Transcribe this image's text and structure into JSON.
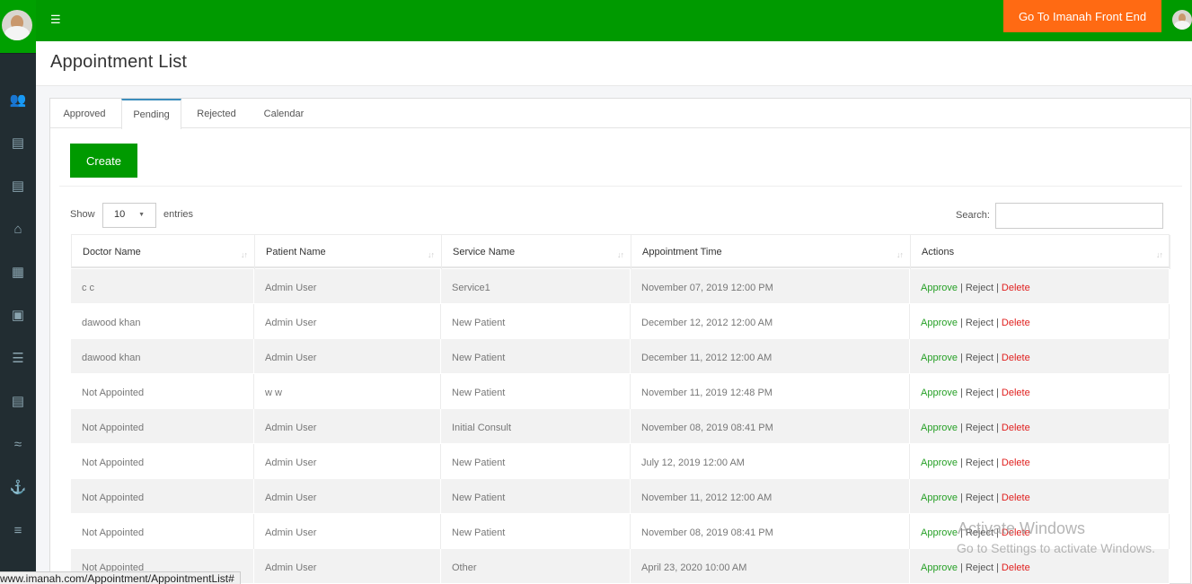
{
  "header": {
    "menu_icon": "hamburger-icon",
    "front_end_button": "Go To Imanah Front End",
    "accent": "#009a00",
    "button_color": "#ff6a13"
  },
  "sidebar": {
    "icons": [
      "users-icon",
      "id-card-icon",
      "id-card-icon",
      "home-icon",
      "calendar-icon",
      "image-icon",
      "list-icon",
      "id-card-icon",
      "handshake-icon",
      "anchor-icon",
      "document-icon"
    ]
  },
  "page": {
    "title": "Appointment List"
  },
  "tabs": [
    "Approved",
    "Pending",
    "Rejected",
    "Calendar"
  ],
  "active_tab": "Pending",
  "create_label": "Create",
  "table_controls": {
    "show_label": "Show",
    "page_length": "10",
    "entries_label": "entries",
    "search_label": "Search:"
  },
  "table": {
    "headers": [
      "Doctor Name",
      "Patient Name",
      "Service Name",
      "Appointment Time",
      "Actions"
    ],
    "actions": {
      "approve": "Approve",
      "reject": "Reject",
      "delete": "Delete",
      "sep": "|"
    },
    "rows": [
      [
        "c c",
        "Admin User",
        "Service1",
        "November 07, 2019 12:00 PM"
      ],
      [
        "dawood khan",
        "Admin User",
        "New Patient",
        "December 12, 2012 12:00 AM"
      ],
      [
        "dawood khan",
        "Admin User",
        "New Patient",
        "December 11, 2012 12:00 AM"
      ],
      [
        "Not Appointed",
        "w w",
        "New Patient",
        "November 11, 2019 12:48 PM"
      ],
      [
        "Not Appointed",
        "Admin User",
        "Initial Consult",
        "November 08, 2019 08:41 PM"
      ],
      [
        "Not Appointed",
        "Admin User",
        "New Patient",
        "July 12, 2019 12:00 AM"
      ],
      [
        "Not Appointed",
        "Admin User",
        "New Patient",
        "November 11, 2012 12:00 AM"
      ],
      [
        "Not Appointed",
        "Admin User",
        "New Patient",
        "November 08, 2019 08:41 PM"
      ],
      [
        "Not Appointed",
        "Admin User",
        "Other",
        "April 23, 2020 10:00 AM"
      ]
    ]
  },
  "watermark": {
    "line1": "Activate Windows",
    "line2": "Go to Settings to activate Windows."
  },
  "status_bar": {
    "url": "www.imanah.com/Appointment/AppointmentList#"
  }
}
